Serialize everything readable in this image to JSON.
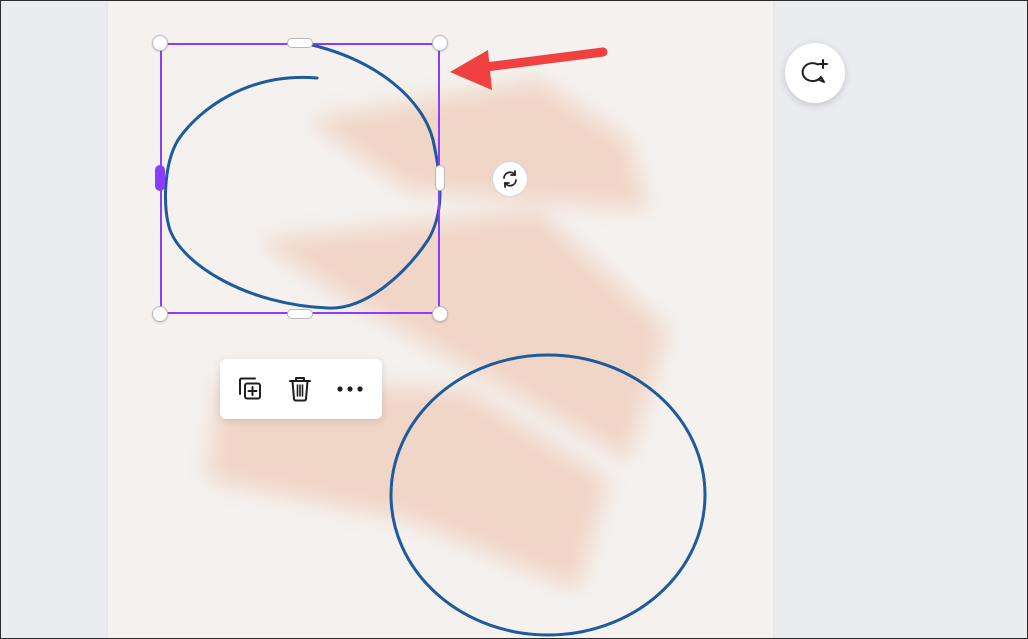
{
  "editor": {
    "workspace_color": "#ebecf0",
    "page_color": "#f4f1ee",
    "selection_color": "#8b3dff",
    "stroke_color": "#1e5a9c",
    "brush_color": "#eec0a8",
    "annotation_color": "#f04040"
  },
  "icons": {
    "rotate": "rotate-icon",
    "duplicate": "duplicate-icon",
    "delete": "trash-icon",
    "more": "more-horizontal-icon",
    "comment": "add-comment-icon",
    "annotation": "red-arrow-icon"
  }
}
